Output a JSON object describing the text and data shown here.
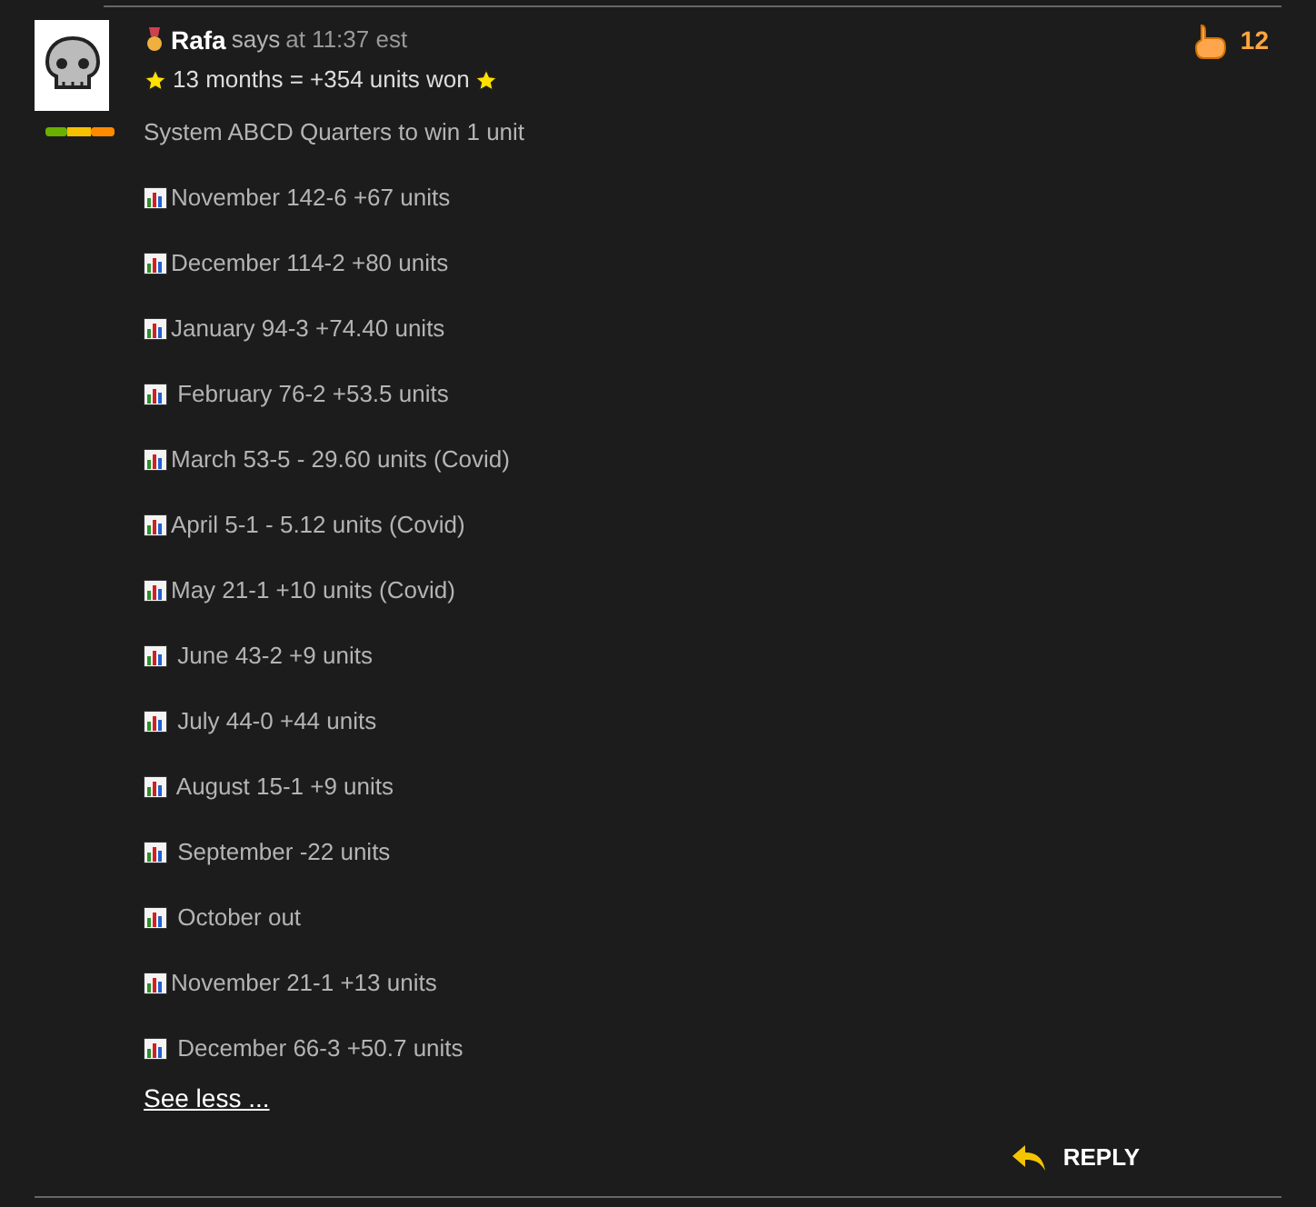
{
  "comment": {
    "author": "Rafa",
    "says": "says",
    "time": "at 11:37 est",
    "headline": "13 months = +354 units won",
    "likes": "12",
    "lines": [
      {
        "kind": "plain",
        "text": "System ABCD Quarters to win 1 unit"
      },
      {
        "kind": "chart",
        "text": "November 142-6 +67 units"
      },
      {
        "kind": "chart",
        "text": "December 114-2 +80 units"
      },
      {
        "kind": "chart",
        "text": "January 94-3 +74.40 units"
      },
      {
        "kind": "chart",
        "text": " February 76-2 +53.5 units"
      },
      {
        "kind": "chart",
        "text": "March 53-5 - 29.60 units (Covid)"
      },
      {
        "kind": "chart",
        "text": "April 5-1 - 5.12 units (Covid)"
      },
      {
        "kind": "chart",
        "text": "May 21-1 +10 units (Covid)"
      },
      {
        "kind": "chart",
        "text": " June 43-2 +9 units"
      },
      {
        "kind": "chart",
        "text": " July 44-0 +44 units"
      },
      {
        "kind": "chart",
        "text": " August 15-1 +9 units"
      },
      {
        "kind": "chart",
        "text": " September -22 units"
      },
      {
        "kind": "chart",
        "text": " October out"
      },
      {
        "kind": "chart",
        "text": "November 21-1 +13 units"
      },
      {
        "kind": "chart",
        "text": " December 66-3 +50.7 units"
      }
    ],
    "see_less": "See less ...",
    "reply": "REPLY"
  }
}
